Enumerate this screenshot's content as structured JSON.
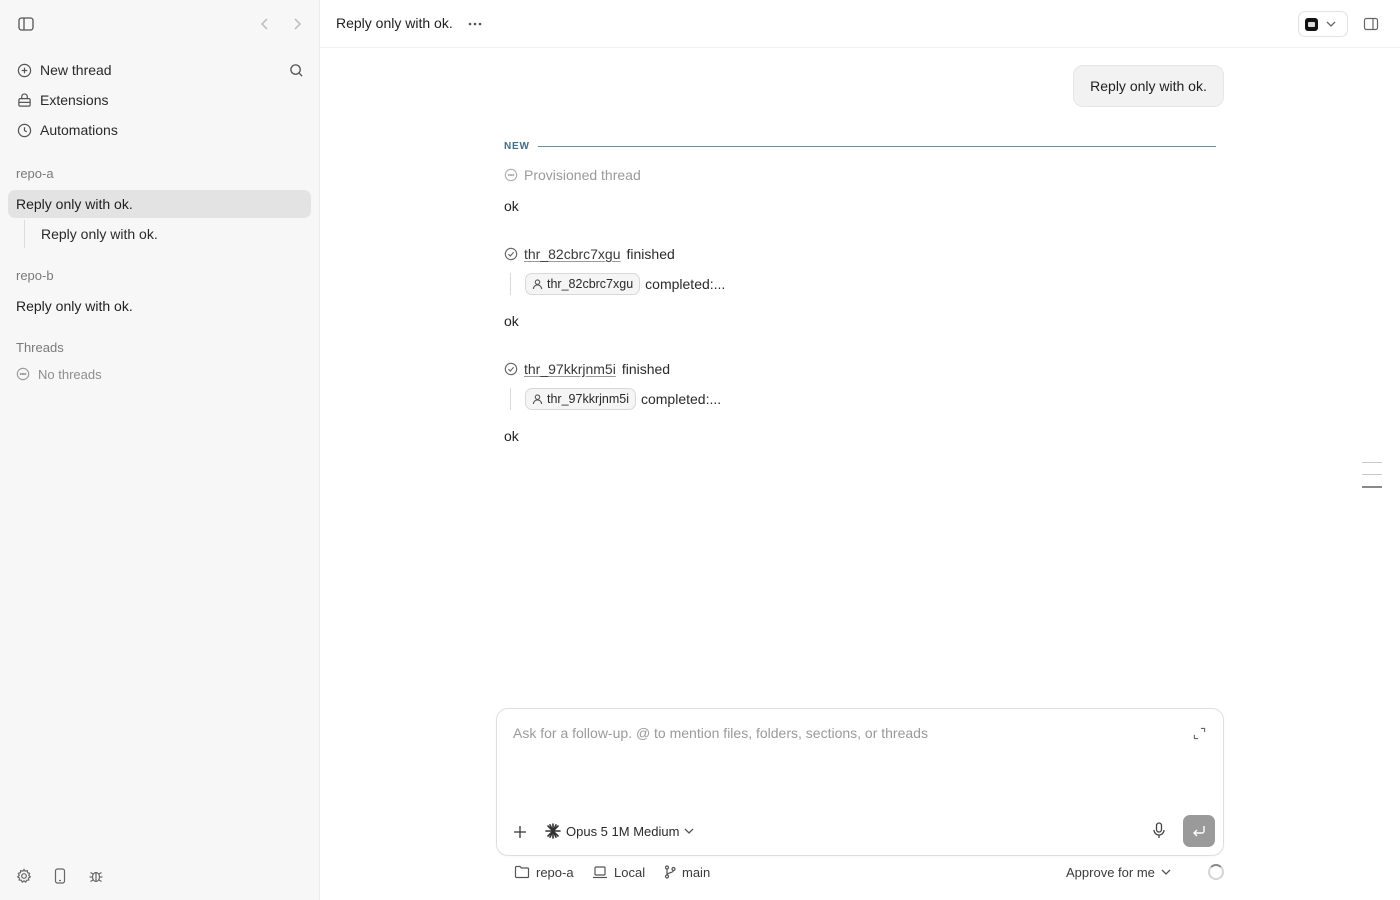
{
  "sidebar": {
    "nav": [
      {
        "label": "New thread",
        "icon": "plus-circle-icon"
      },
      {
        "label": "Extensions",
        "icon": "extensions-icon"
      },
      {
        "label": "Automations",
        "icon": "clock-icon"
      }
    ],
    "groups": [
      {
        "name": "repo-a",
        "threads": [
          "Reply only with ok."
        ],
        "subthreads": [
          "Reply only with ok."
        ]
      },
      {
        "name": "repo-b",
        "threads": [
          "Reply only with ok."
        ]
      }
    ],
    "threads_section": {
      "label": "Threads",
      "empty_text": "No threads"
    }
  },
  "header": {
    "title": "Reply only with ok."
  },
  "conversation": {
    "user_message": "Reply only with ok.",
    "new_marker": "NEW",
    "provisioned": "Provisioned thread",
    "replies": [
      "ok",
      "ok",
      "ok"
    ],
    "events": [
      {
        "thread_id": "thr_82cbrc7xgu",
        "status": "finished",
        "chip": "thr_82cbrc7xgu",
        "result": "completed:..."
      },
      {
        "thread_id": "thr_97kkrjnm5i",
        "status": "finished",
        "chip": "thr_97kkrjnm5i",
        "result": "completed:..."
      }
    ]
  },
  "composer": {
    "placeholder": "Ask for a follow-up. @ to mention files, folders, sections, or threads",
    "model": "Opus 5 1M Medium"
  },
  "footer": {
    "repo": "repo-a",
    "environment": "Local",
    "branch": "main",
    "approval": "Approve for me"
  }
}
